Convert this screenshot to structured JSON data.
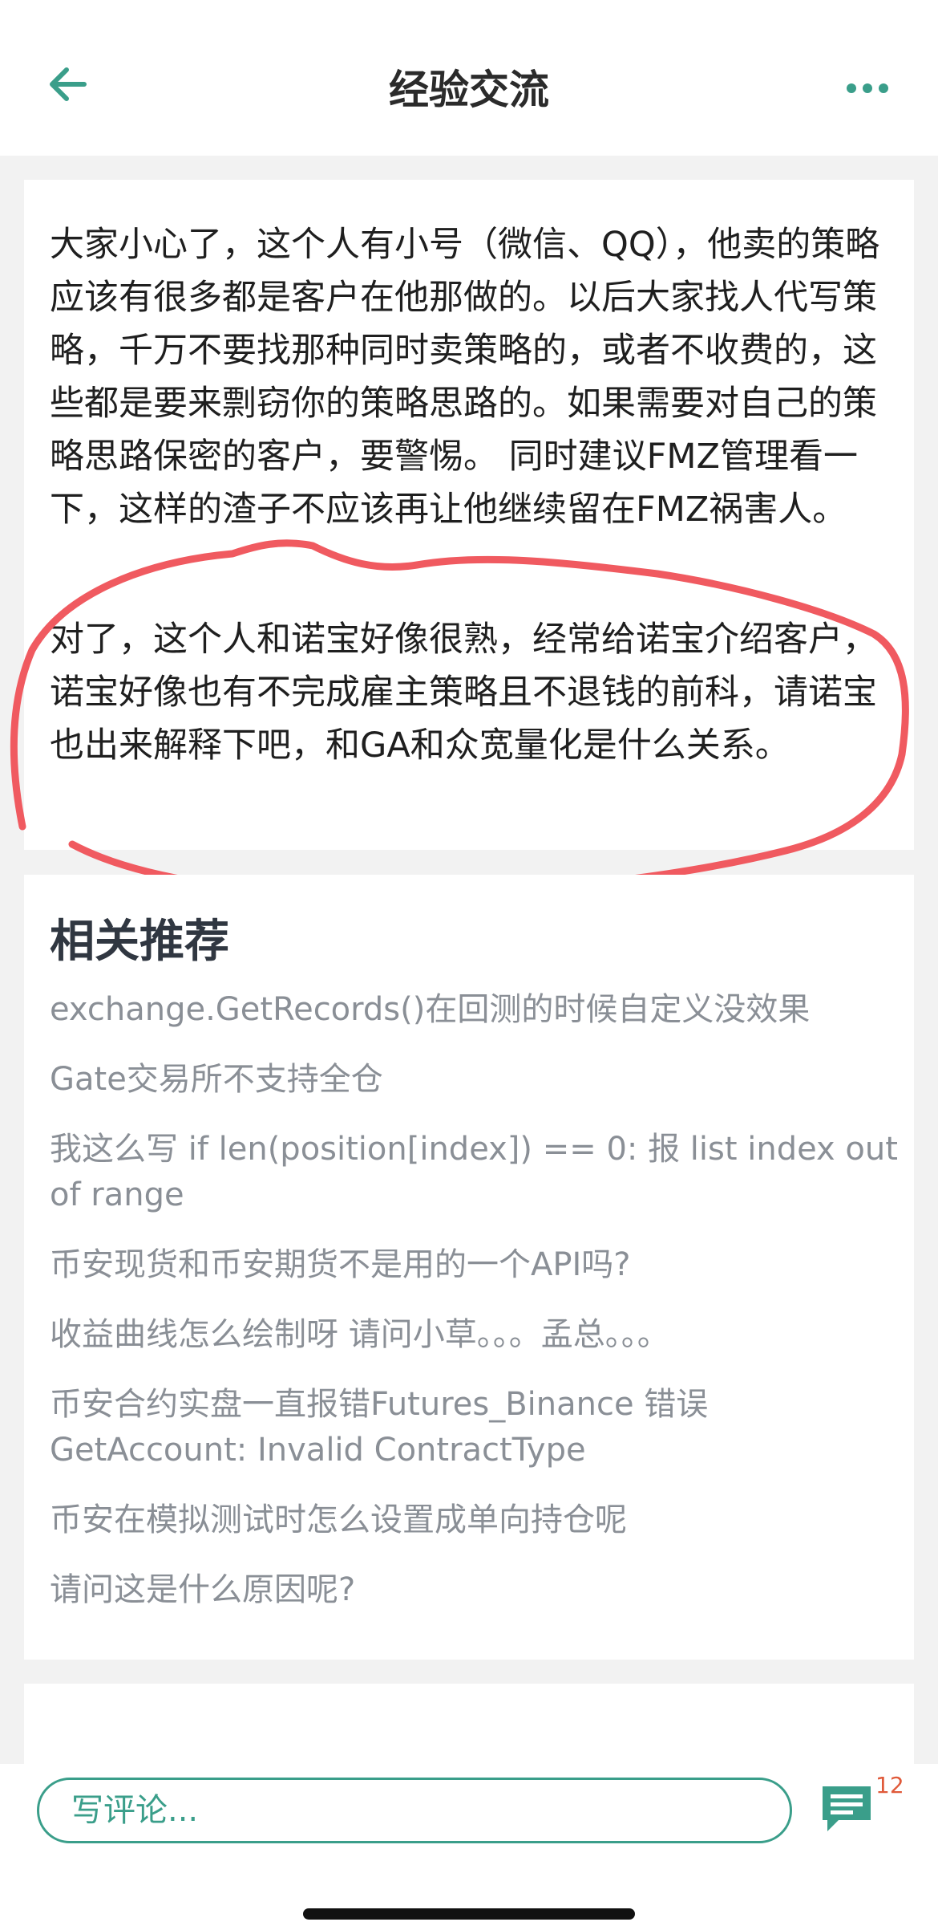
{
  "header": {
    "title": "经验交流",
    "back_icon": "arrow-left-icon",
    "more_icon": "more-dots-icon"
  },
  "post": {
    "paragraphs": [
      "大家小心了，这个人有小号（微信、QQ），他卖的策略应该有很多都是客户在他那做的。以后大家找人代写策略，千万不要找那种同时卖策略的，或者不收费的，这些都是要来剽窃你的策略思路的。如果需要对自己的策略思路保密的客户，要警惕。 同时建议FMZ管理看一下，这样的渣子不应该再让他继续留在FMZ祸害人。",
      "对了，这个人和诺宝好像很熟，经常给诺宝介绍客户，诺宝好像也有不完成雇主策略且不退钱的前科，请诺宝也出来解释下吧，和GA和众宽量化是什么关系。"
    ]
  },
  "related": {
    "title": "相关推荐",
    "items": [
      "exchange.GetRecords()在回测的时候自定义没效果",
      "Gate交易所不支持全仓",
      "我这么写 if len(position[index]) == 0: 报 list index out of range",
      "币安现货和币安期货不是用的一个API吗?",
      "收益曲线怎么绘制呀 请问小草。。。孟总。。。",
      "币安合约实盘一直报错Futures_Binance 错误 GetAccount: Invalid ContractType",
      "币安在模拟测试时怎么设置成单向持仓呢",
      "请问这是什么原因呢?"
    ]
  },
  "bottom": {
    "comment_placeholder": "写评论...",
    "comment_count": "12",
    "comment_icon": "comment-bubble-icon"
  },
  "colors": {
    "accent": "#3a9e8a",
    "annotation": "#f05a60",
    "badge": "#e05a3a",
    "muted_text": "#8a8f96"
  }
}
